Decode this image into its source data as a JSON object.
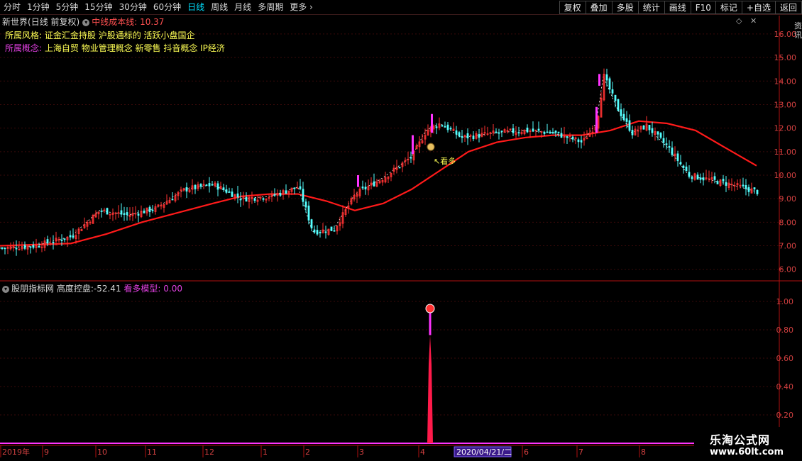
{
  "toolbar": {
    "periods": [
      "分时",
      "1分钟",
      "5分钟",
      "15分钟",
      "30分钟",
      "60分钟",
      "日线",
      "周线",
      "月线",
      "多周期",
      "更多"
    ],
    "selected_period": "日线",
    "more_arrow": "›",
    "right_buttons": [
      "复权",
      "叠加",
      "多股",
      "统计",
      "画线",
      "F10",
      "标记",
      "+自选",
      "返回"
    ]
  },
  "header": {
    "stock_name": "新世界",
    "chart_mode": "(日线 前复权)",
    "indicator_label": "中线成本线:",
    "indicator_value": "10.37"
  },
  "tags": {
    "style_label": "所属风格:",
    "style_value": "证金汇金持股 沪股通标的 活跃小盘国企",
    "concept_label": "所属概念:",
    "concept_value": "上海自贸 物业管理概念 新零售 抖音概念 IP经济"
  },
  "lower_panel": {
    "name": "股朋指标网",
    "height_label": "高度控盘:",
    "height_value": "-52.41",
    "model_label": "看多模型:",
    "model_value": "0.00"
  },
  "annotation": {
    "text": "↖看多",
    "icon": "money-bag-icon"
  },
  "x_axis": {
    "labels": [
      "2019年",
      "9",
      "10",
      "11",
      "12",
      "1",
      "2",
      "3",
      "4",
      "6",
      "7",
      "8"
    ],
    "cursor_date": "2020/04/21/二"
  },
  "y_axis_price": [
    "16.00",
    "15.00",
    "14.00",
    "13.00",
    "12.00",
    "11.00",
    "10.00",
    "9.00",
    "8.00",
    "7.00",
    "6.00"
  ],
  "y_axis_indicator": [
    "1.00",
    "0.80",
    "0.60",
    "0.40",
    "0.20"
  ],
  "right_tab_text": "资讯",
  "watermark": {
    "line1": "乐淘公式网",
    "line2": "www.60lt.com"
  },
  "colors": {
    "up": "#ff3232",
    "down": "#54ffff",
    "ma": "#ff1a1a",
    "signal": "#ff33ff",
    "axis": "#b01010"
  },
  "chart_data": {
    "type": "candlestick",
    "price_range": [
      5.6,
      16.6
    ],
    "indicator_range": [
      0,
      1.1
    ],
    "cost_line_samples": [
      [
        0,
        7.0
      ],
      [
        100,
        7.1
      ],
      [
        150,
        7.5
      ],
      [
        200,
        8.0
      ],
      [
        250,
        8.4
      ],
      [
        300,
        8.8
      ],
      [
        340,
        9.1
      ],
      [
        380,
        9.2
      ],
      [
        420,
        9.2
      ],
      [
        460,
        8.9
      ],
      [
        500,
        8.5
      ],
      [
        540,
        8.8
      ],
      [
        580,
        9.4
      ],
      [
        620,
        10.2
      ],
      [
        660,
        11.0
      ],
      [
        700,
        11.4
      ],
      [
        740,
        11.6
      ],
      [
        780,
        11.7
      ],
      [
        820,
        11.7
      ],
      [
        860,
        11.9
      ],
      [
        900,
        12.3
      ],
      [
        940,
        12.2
      ],
      [
        980,
        11.9
      ],
      [
        1020,
        11.2
      ],
      [
        1066,
        10.4
      ]
    ],
    "close_samples": [
      [
        0,
        6.9
      ],
      [
        50,
        7.0
      ],
      [
        100,
        7.4
      ],
      [
        140,
        8.5
      ],
      [
        180,
        8.3
      ],
      [
        220,
        8.6
      ],
      [
        260,
        9.4
      ],
      [
        300,
        9.6
      ],
      [
        340,
        9.0
      ],
      [
        380,
        9.1
      ],
      [
        420,
        9.5
      ],
      [
        440,
        7.6
      ],
      [
        470,
        7.7
      ],
      [
        500,
        9.2
      ],
      [
        540,
        9.9
      ],
      [
        580,
        10.8
      ],
      [
        600,
        11.9
      ],
      [
        620,
        12.2
      ],
      [
        650,
        11.6
      ],
      [
        700,
        11.8
      ],
      [
        740,
        11.9
      ],
      [
        780,
        11.8
      ],
      [
        820,
        11.4
      ],
      [
        840,
        12.2
      ],
      [
        850,
        14.2
      ],
      [
        870,
        12.8
      ],
      [
        890,
        11.8
      ],
      [
        910,
        12.1
      ],
      [
        940,
        11.2
      ],
      [
        970,
        10.0
      ],
      [
        1000,
        9.8
      ],
      [
        1030,
        9.6
      ],
      [
        1066,
        9.3
      ]
    ],
    "signal_index_x": 606,
    "signal_value": 0.93
  }
}
